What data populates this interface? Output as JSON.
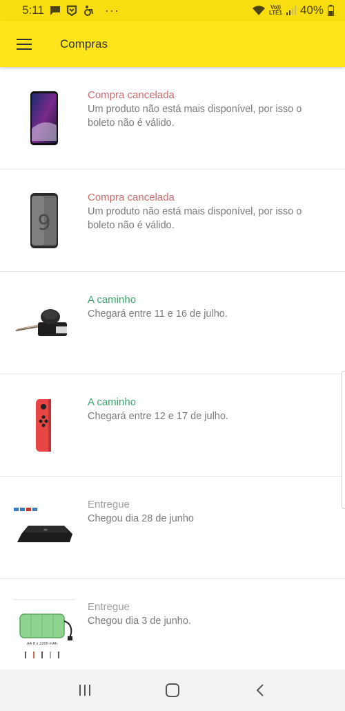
{
  "status_bar": {
    "time": "5:11",
    "dots": "···",
    "volte_top": "Vo))",
    "volte_bottom": "LTE1",
    "battery": "40%"
  },
  "app_bar": {
    "title": "Compras"
  },
  "colors": {
    "accent": "#ffe51a",
    "cancelled": "#c86b6b",
    "in_transit": "#3fa56a",
    "delivered": "#9e9e9e"
  },
  "purchases": [
    {
      "status": "Compra cancelada",
      "status_type": "cancelled",
      "description": "Um produto não está mais disponível, por isso o boleto não é válido.",
      "thumbnail": "phone-black-icon"
    },
    {
      "status": "Compra cancelada",
      "status_type": "cancelled",
      "description": "Um produto não está mais disponível, por isso o boleto não é válido.",
      "thumbnail": "phone-gray-icon"
    },
    {
      "status": "A caminho",
      "status_type": "in_transit",
      "description": "Chegará entre 11 e 16 de julho.",
      "thumbnail": "joystick-module-icon"
    },
    {
      "status": "A caminho",
      "status_type": "in_transit",
      "description": "Chegará entre 12 e 17 de julho.",
      "thumbnail": "red-controller-icon"
    },
    {
      "status": "Entregue",
      "status_type": "delivered",
      "description": "Chegou dia 28 de junho",
      "thumbnail": "charging-pad-icon"
    },
    {
      "status": "Entregue",
      "status_type": "delivered",
      "description": "Chegou dia 3 de junho.",
      "thumbnail": "battery-pack-icon",
      "thumbnail_text": "AA 8 x 2200 mAh"
    }
  ],
  "nav_bar": {
    "recents_icon": "recents-icon",
    "home_icon": "home-icon",
    "back_icon": "back-icon"
  }
}
